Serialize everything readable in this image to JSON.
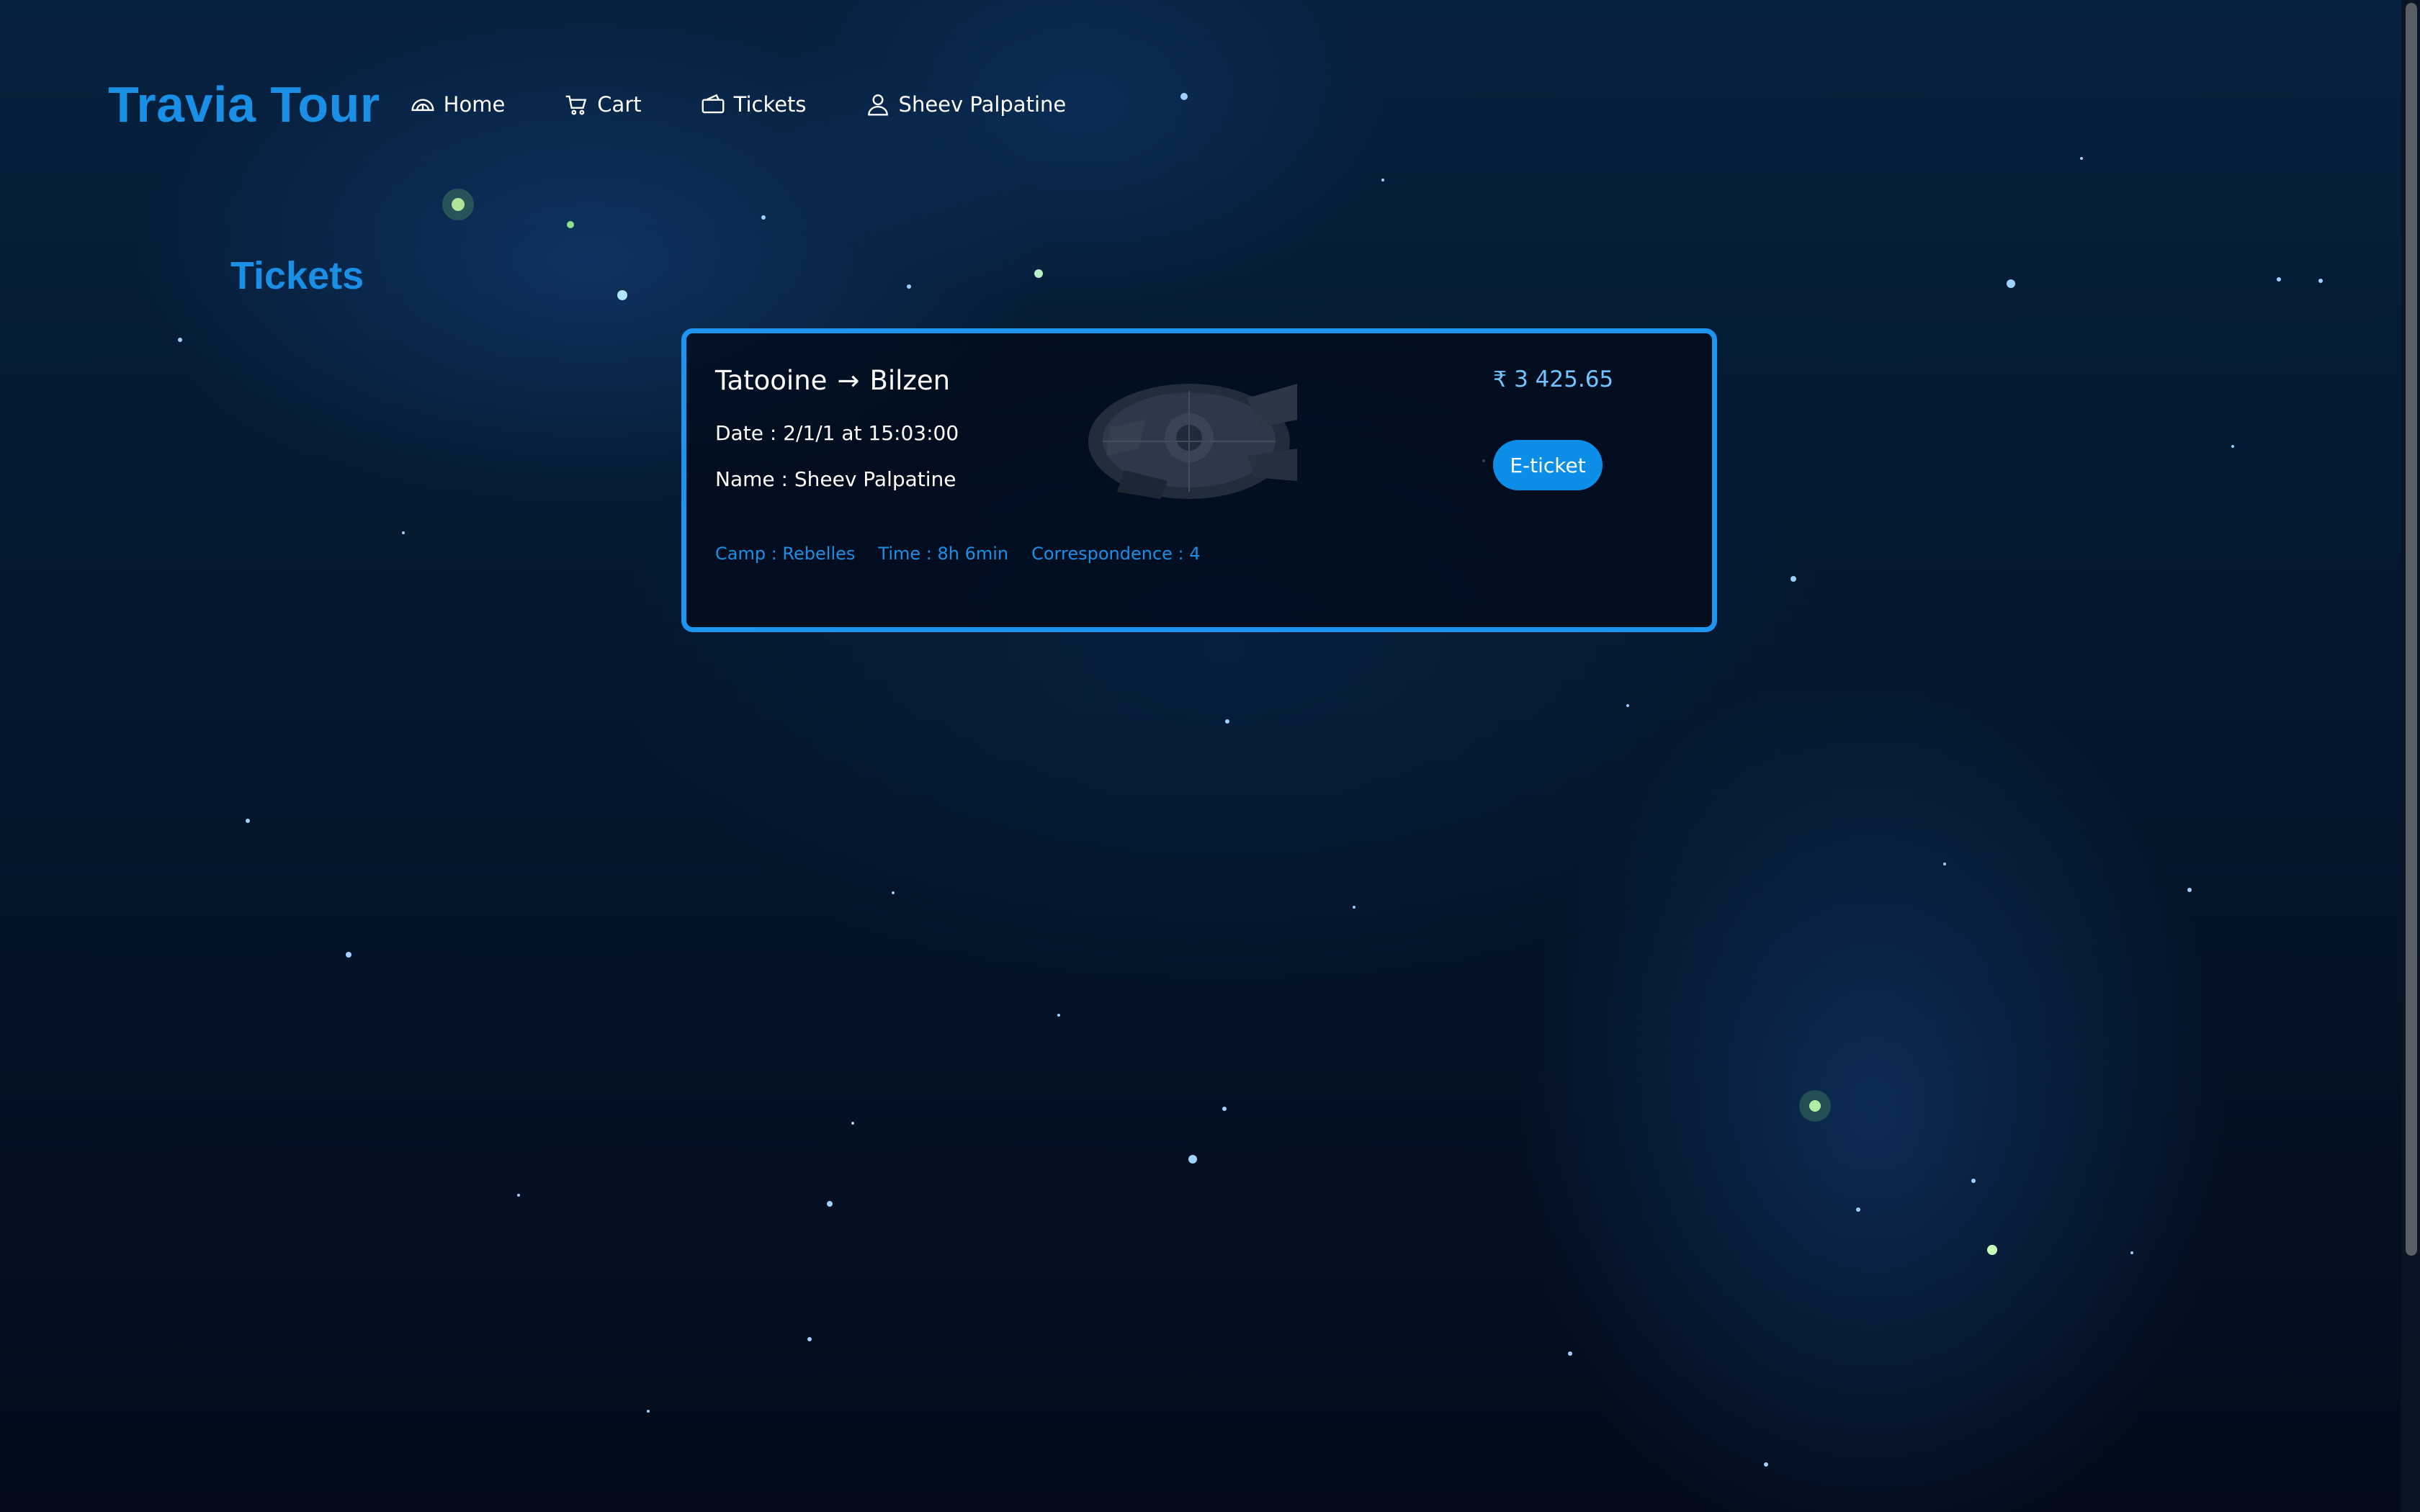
{
  "app": {
    "name": "Travia Tour"
  },
  "nav": {
    "items": [
      {
        "label": "Home",
        "icon": "home-dome-icon"
      },
      {
        "label": "Cart",
        "icon": "cart-icon"
      },
      {
        "label": "Tickets",
        "icon": "ticket-icon"
      },
      {
        "label": "Sheev Palpatine",
        "icon": "user-icon"
      }
    ]
  },
  "page": {
    "title": "Tickets"
  },
  "ticket": {
    "origin": "Tatooine",
    "arrow": "→",
    "destination": "Bilzen",
    "date_line": "Date : 2/1/1 at 15:03:00",
    "name_line": "Name : Sheev Palpatine",
    "camp": "Camp : Rebelles",
    "time": "Time : 8h 6min",
    "correspondence": "Correspondence : 4",
    "price": "3 425.65",
    "price_symbol": "₹",
    "eticket_label": "E-ticket",
    "image_icon": "spaceship-icon"
  },
  "colors": {
    "accent": "#1a8fe6",
    "card_border": "#1c94f0",
    "price": "#70c4ff",
    "button": "#0c8ee8"
  }
}
